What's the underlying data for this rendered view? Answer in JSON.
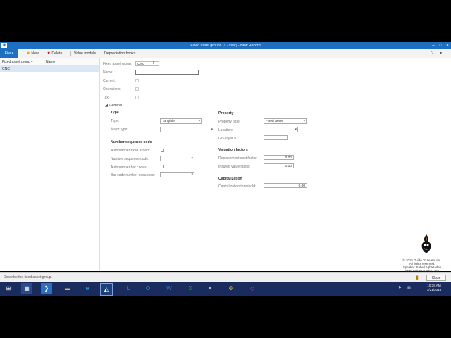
{
  "window": {
    "title": "Fixed asset groups (1 - ssar) - New Record",
    "app_icon": "ax-icon"
  },
  "menu": {
    "file": "File",
    "new": "New",
    "delete": "Delete",
    "value_models": "Value models",
    "depreciation_books": "Depreciation books"
  },
  "grid": {
    "col_group": "Fixed asset group",
    "col_name": "Name",
    "rows": [
      {
        "group": "CNC"
      }
    ]
  },
  "form": {
    "fixed_asset_group_label": "Fixed asset group:",
    "fixed_asset_group_value": "CNC",
    "name_label": "Name:",
    "name_value": "",
    "current_label": "Current:",
    "operations_label": "Operations:",
    "tax_label": "Tax:"
  },
  "general": {
    "header": "General",
    "type": {
      "header": "Type",
      "type_label": "Type:",
      "type_value": "Tangible",
      "major_type_label": "Major type:",
      "major_type_value": ""
    },
    "number_sequence": {
      "header": "Number sequence code",
      "autonumber_label": "Autonumber fixed assets:",
      "number_sequence_label": "Number sequence code:",
      "autonumber_bar_label": "Autonumber bar codes:",
      "bar_code_seq_label": "Bar code number sequence:"
    },
    "property": {
      "header": "Property",
      "property_type_label": "Property type:",
      "property_type_value": "Fixed asset",
      "location_label": "Location:",
      "gis_label": "GIS layer ID:"
    },
    "valuation": {
      "header": "Valuation factors",
      "replacement_label": "Replacement cost factor:",
      "replacement_value": "0.00",
      "insured_label": "Insured value factor:",
      "insured_value": "0.00"
    },
    "capitalization": {
      "header": "Capitalization",
      "threshold_label": "Capitalization threshold:",
      "threshold_value": "0.00"
    }
  },
  "status": {
    "text": "Describe the fixed asset group.",
    "close": "Close"
  },
  "copyright": {
    "line1": "© 2015 Guide To Learn, Inc.",
    "line2": "All rights reserved.",
    "line3": "Speaker: Soheil Aghazadeh",
    "line4": "www.GuideToLearn.com"
  },
  "clock": {
    "time": "10:38 AM",
    "date": "1/21/2015"
  },
  "colors": {
    "accent": "#1e6fc1",
    "taskbar": "#1a2b5e"
  }
}
